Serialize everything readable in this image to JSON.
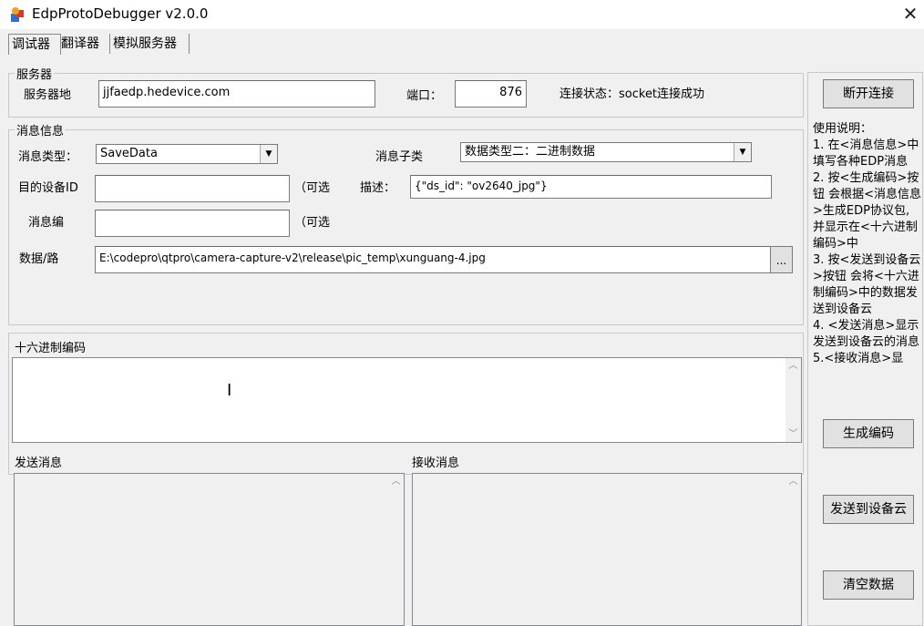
{
  "window": {
    "title": "EdpProtoDebugger v2.0.0",
    "close_glyph": "✕",
    "icon": "app-icon"
  },
  "tabs": [
    {
      "label": "调试器",
      "active": true
    },
    {
      "label": "翻译器",
      "active": false
    },
    {
      "label": "模拟服务器",
      "active": false
    }
  ],
  "server": {
    "group_title": "服务器",
    "address_label": "服务器地",
    "address_value": "jjfaedp.hedevice.com",
    "port_label": "端口：",
    "port_value": "876",
    "status_text": "连接状态：socket连接成功",
    "disconnect_label": "断开连接"
  },
  "message": {
    "group_title": "消息信息",
    "type_label": "消息类型：",
    "type_value": "SaveData",
    "subtype_label": "消息子类",
    "subtype_value": "数据类型二：二进制数据",
    "device_id_label": "目的设备ID",
    "device_id_value": "",
    "optional_1": "（可选",
    "desc_label": "描述：",
    "desc_value": "{\"ds_id\": \"ov2640_jpg\"}",
    "msg_num_label": "消息编",
    "msg_num_value": "",
    "optional_2": "（可选",
    "data_path_label": "数据/路",
    "data_path_value": "E:\\codepro\\qtpro\\camera-capture-v2\\release\\pic_temp\\xunguang-4.jpg",
    "browse_label": "..."
  },
  "hex": {
    "title": "十六进制编码",
    "value": ""
  },
  "send": {
    "title": "发送消息",
    "value": ""
  },
  "recv": {
    "title": "接收消息",
    "value": ""
  },
  "help": {
    "text": "使用说明：\n1. 在<消息信息>中填写各种EDP消息\n2. 按<生成编码>按钮 会根据<消息信息>生成EDP协议包, 并显示在<十六进制编码>中\n3. 按<发送到设备云>按钮 会将<十六进制编码>中的数据发送到设备云\n4. <发送消息>显示发送到设备云的消息\n5.<接收消息>显"
  },
  "actions": {
    "generate_label": "生成编码",
    "send_cloud_label": "发送到设备云",
    "clear_label": "清空数据"
  },
  "glyphs": {
    "combo_arrow": "▼",
    "scroll_up": "︿",
    "scroll_down": "﹀",
    "text_cursor": "I"
  }
}
